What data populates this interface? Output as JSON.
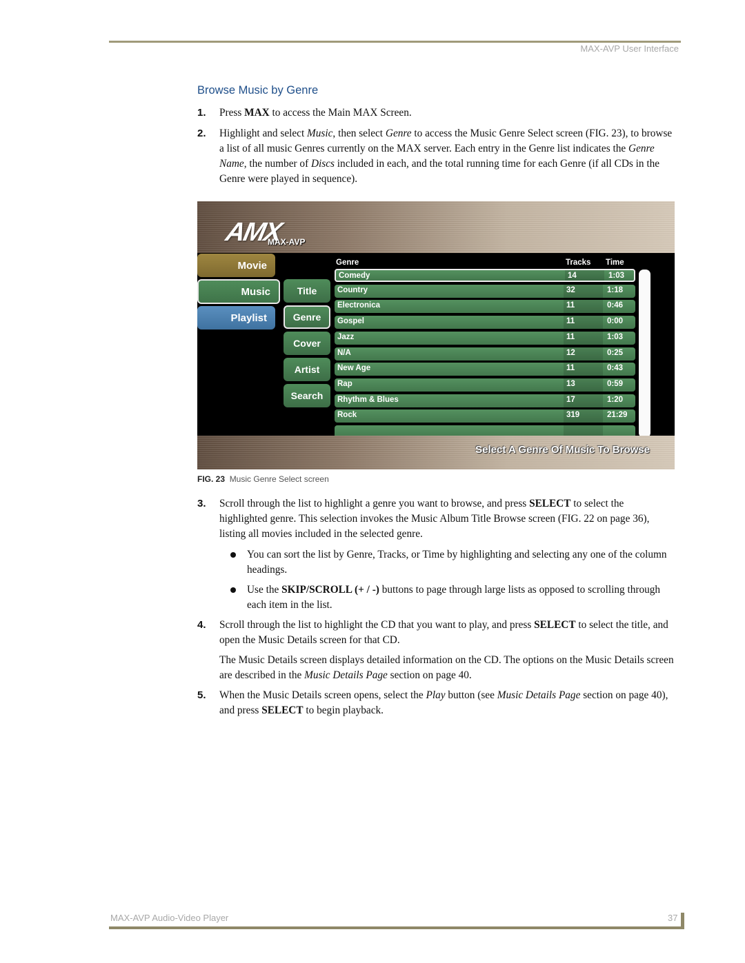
{
  "header": {
    "running_head": "MAX-AVP User Interface"
  },
  "section": {
    "title": "Browse Music by Genre"
  },
  "steps": {
    "s1": {
      "num": "1.",
      "pre": "Press ",
      "bold": "MAX",
      "post": " to access the Main MAX Screen."
    },
    "s2": {
      "num": "2.",
      "t1": "Highlight and select ",
      "i1": "Music",
      "t2": ", then select ",
      "i2": "Genre",
      "t3": " to access the Music Genre Select screen (FIG. 23), to browse a list of all music Genres currently on the MAX server. Each entry in the Genre list indicates the ",
      "i3": "Genre Name",
      "t4": ", the number of ",
      "i4": "Discs",
      "t5": " included in each, and the total running time for each Genre (if all CDs in the Genre were played in sequence)."
    },
    "s3": {
      "num": "3.",
      "t1": "Scroll through the list to highlight a genre you want to browse, and press ",
      "b1": "SELECT",
      "t2": " to select the highlighted genre. This selection invokes the Music Album Title Browse screen (FIG. 22 on page 36), listing all movies included in the selected genre."
    },
    "b1": {
      "text": "You can sort the list by Genre, Tracks, or Time by highlighting and selecting any one of the column headings."
    },
    "b2": {
      "t1": "Use the ",
      "b1": "SKIP/SCROLL (+ / -)",
      "t2": " buttons to page through large lists as opposed to scrolling through each item in the list."
    },
    "s4": {
      "num": "4.",
      "t1": "Scroll through the list to highlight the CD that you want to play, and press ",
      "b1": "SELECT",
      "t2": " to select the title, and open the Music Details screen for that CD."
    },
    "p4": {
      "t1": "The Music Details screen displays detailed information on the CD. The options on the Music Details screen are described in the ",
      "i1": "Music Details Page",
      "t2": " section on page 40."
    },
    "s5": {
      "num": "5.",
      "t1": "When the Music Details screen opens, select the ",
      "i1": "Play",
      "t2": " button (see ",
      "i2": "Music Details Page",
      "t3": " section on page 40), and press ",
      "b1": "SELECT",
      "t4": " to begin playback."
    }
  },
  "figure": {
    "logo": "AMX",
    "logo_sub": "MAX-AVP",
    "nav": {
      "movie": "Movie",
      "music": "Music",
      "playlist": "Playlist"
    },
    "sub_nav": [
      "Title",
      "Genre",
      "Cover",
      "Artist",
      "Search"
    ],
    "columns": {
      "genre": "Genre",
      "tracks": "Tracks",
      "time": "Time"
    },
    "rows": [
      {
        "genre": "Comedy",
        "tracks": "14",
        "time": "1:03"
      },
      {
        "genre": "Country",
        "tracks": "32",
        "time": "1:18"
      },
      {
        "genre": "Electronica",
        "tracks": "11",
        "time": "0:46"
      },
      {
        "genre": "Gospel",
        "tracks": "11",
        "time": "0:00"
      },
      {
        "genre": "Jazz",
        "tracks": "11",
        "time": "1:03"
      },
      {
        "genre": "N/A",
        "tracks": "12",
        "time": "0:25"
      },
      {
        "genre": "New Age",
        "tracks": "11",
        "time": "0:43"
      },
      {
        "genre": "Rap",
        "tracks": "13",
        "time": "0:59"
      },
      {
        "genre": "Rhythm & Blues",
        "tracks": "17",
        "time": "1:20"
      },
      {
        "genre": "Rock",
        "tracks": "319",
        "time": "21:29"
      },
      {
        "genre": "",
        "tracks": "",
        "time": ""
      }
    ],
    "banner": "Select A Genre Of Music To Browse",
    "caption_label": "FIG. 23",
    "caption_text": "Music Genre Select screen"
  },
  "footer": {
    "left": "MAX-AVP Audio-Video Player",
    "page": "37"
  }
}
